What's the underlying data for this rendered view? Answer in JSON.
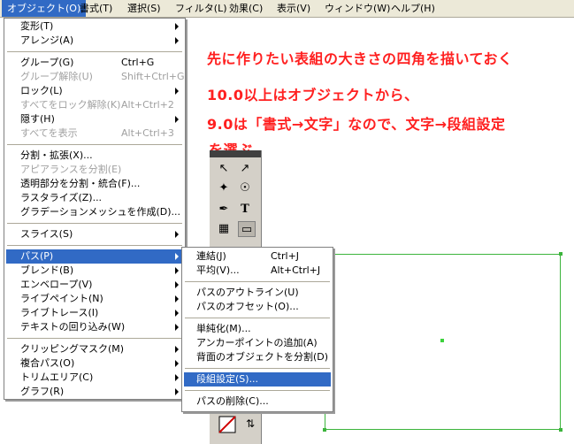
{
  "menubar": {
    "items": [
      "オブジェクト(O)",
      "書式(T)",
      "選択(S)",
      "フィルタ(L)",
      "効果(C)",
      "表示(V)",
      "ウィンドウ(W)",
      "ヘルプ(H)"
    ]
  },
  "object_menu": {
    "items": [
      {
        "label": "変形(T)",
        "shortcut": "",
        "submenu": true,
        "disabled": false
      },
      {
        "label": "アレンジ(A)",
        "shortcut": "",
        "submenu": true,
        "disabled": false
      },
      {
        "label": "グループ(G)",
        "shortcut": "Ctrl+G",
        "submenu": false,
        "disabled": false
      },
      {
        "label": "グループ解除(U)",
        "shortcut": "Shift+Ctrl+G",
        "submenu": false,
        "disabled": true
      },
      {
        "label": "ロック(L)",
        "shortcut": "",
        "submenu": true,
        "disabled": false
      },
      {
        "label": "すべてをロック解除(K)",
        "shortcut": "Alt+Ctrl+2",
        "submenu": false,
        "disabled": true
      },
      {
        "label": "隠す(H)",
        "shortcut": "",
        "submenu": true,
        "disabled": false
      },
      {
        "label": "すべてを表示",
        "shortcut": "Alt+Ctrl+3",
        "submenu": false,
        "disabled": true
      },
      {
        "label": "分割・拡張(X)...",
        "shortcut": "",
        "submenu": false,
        "disabled": false
      },
      {
        "label": "アピアランスを分割(E)",
        "shortcut": "",
        "submenu": false,
        "disabled": true
      },
      {
        "label": "透明部分を分割・統合(F)...",
        "shortcut": "",
        "submenu": false,
        "disabled": false
      },
      {
        "label": "ラスタライズ(Z)...",
        "shortcut": "",
        "submenu": false,
        "disabled": false
      },
      {
        "label": "グラデーションメッシュを作成(D)...",
        "shortcut": "",
        "submenu": false,
        "disabled": false
      },
      {
        "label": "スライス(S)",
        "shortcut": "",
        "submenu": true,
        "disabled": false
      },
      {
        "label": "パス(P)",
        "shortcut": "",
        "submenu": true,
        "disabled": false
      },
      {
        "label": "ブレンド(B)",
        "shortcut": "",
        "submenu": true,
        "disabled": false
      },
      {
        "label": "エンベロープ(V)",
        "shortcut": "",
        "submenu": true,
        "disabled": false
      },
      {
        "label": "ライブペイント(N)",
        "shortcut": "",
        "submenu": true,
        "disabled": false
      },
      {
        "label": "ライブトレース(I)",
        "shortcut": "",
        "submenu": true,
        "disabled": false
      },
      {
        "label": "テキストの回り込み(W)",
        "shortcut": "",
        "submenu": true,
        "disabled": false
      },
      {
        "label": "クリッピングマスク(M)",
        "shortcut": "",
        "submenu": true,
        "disabled": false
      },
      {
        "label": "複合パス(O)",
        "shortcut": "",
        "submenu": true,
        "disabled": false
      },
      {
        "label": "トリムエリア(C)",
        "shortcut": "",
        "submenu": true,
        "disabled": false
      },
      {
        "label": "グラフ(R)",
        "shortcut": "",
        "submenu": true,
        "disabled": false
      }
    ]
  },
  "path_submenu": {
    "items": [
      {
        "label": "連結(J)",
        "shortcut": "Ctrl+J"
      },
      {
        "label": "平均(V)...",
        "shortcut": "Alt+Ctrl+J"
      },
      {
        "label": "パスのアウトライン(U)",
        "shortcut": ""
      },
      {
        "label": "パスのオフセット(O)...",
        "shortcut": ""
      },
      {
        "label": "単純化(M)...",
        "shortcut": ""
      },
      {
        "label": "アンカーポイントの追加(A)",
        "shortcut": ""
      },
      {
        "label": "背面のオブジェクトを分割(D)",
        "shortcut": ""
      },
      {
        "label": "段組設定(S)...",
        "shortcut": ""
      },
      {
        "label": "パスの削除(C)...",
        "shortcut": ""
      }
    ]
  },
  "notes": {
    "line1": "先に作りたい表組の大きさの四角を描いておく",
    "line2": "10.0以上はオブジェクトから、",
    "line3": "9.0は「書式→文字」なので、文字→段組設定",
    "line4": "を選ぶ"
  },
  "colors": {
    "highlight": "#316ac5",
    "note_red": "#ff2020",
    "selection_green": "#3cb43c"
  }
}
